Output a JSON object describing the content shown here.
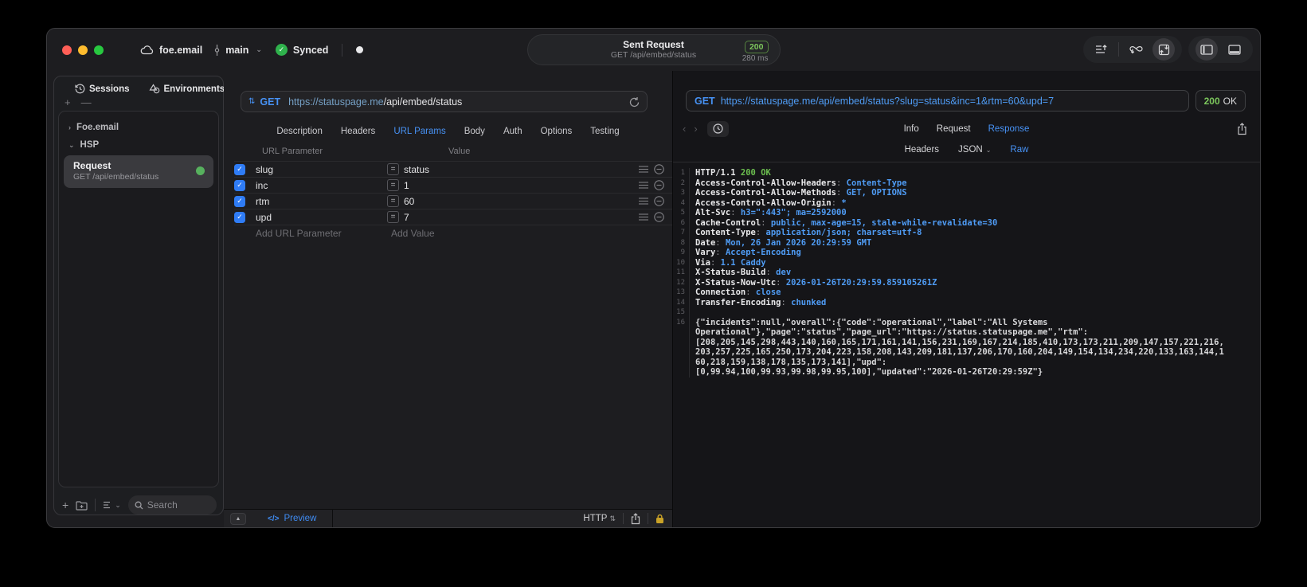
{
  "titlebar": {
    "project": "foe.email",
    "branch": "main",
    "sync_status": "Synced",
    "request_title": "Sent Request",
    "request_subtitle": "GET /api/embed/status",
    "status_badge": "200",
    "duration": "280 ms"
  },
  "sidebar": {
    "tabs": [
      {
        "label": "Sessions"
      },
      {
        "label": "Environments"
      }
    ],
    "groups": [
      {
        "label": "Foe.email"
      },
      {
        "label": "HSP"
      }
    ],
    "request_item": {
      "title": "Request",
      "subtitle": "GET /api/embed/status"
    },
    "search_placeholder": "Search"
  },
  "request_panel": {
    "method": "GET",
    "url_host": "https://statuspage.me",
    "url_path": "/api/embed/status",
    "tabs": [
      "Description",
      "Headers",
      "URL Params",
      "Body",
      "Auth",
      "Options",
      "Testing"
    ],
    "active_tab": "URL Params",
    "params": {
      "col_param": "URL Parameter",
      "col_value": "Value",
      "rows": [
        {
          "name": "slug",
          "value": "status",
          "enabled": true
        },
        {
          "name": "inc",
          "value": "1",
          "enabled": true
        },
        {
          "name": "rtm",
          "value": "60",
          "enabled": true
        },
        {
          "name": "upd",
          "value": "7",
          "enabled": true
        }
      ],
      "add_param_placeholder": "Add URL Parameter",
      "add_value_placeholder": "Add Value"
    },
    "footer": {
      "preview_label": "Preview",
      "code_glyph": "</>",
      "protocol_label": "HTTP"
    }
  },
  "response_panel": {
    "method": "GET",
    "url": "https://statuspage.me/api/embed/status?slug=status&inc=1&rtm=60&upd=7",
    "status_code": "200",
    "status_text": "OK",
    "tabs": [
      "Info",
      "Request",
      "Response"
    ],
    "active_tab": "Response",
    "subtabs": [
      "Headers",
      "JSON",
      "Raw"
    ],
    "active_subtab": "Raw",
    "status_line": {
      "protocol": "HTTP/1.1 ",
      "status": "200 OK"
    },
    "headers": [
      {
        "name": "Access-Control-Allow-Headers",
        "value": "Content-Type"
      },
      {
        "name": "Access-Control-Allow-Methods",
        "value": "GET, OPTIONS"
      },
      {
        "name": "Access-Control-Allow-Origin",
        "value": "*"
      },
      {
        "name": "Alt-Svc",
        "value": "h3=\":443\"; ma=2592000"
      },
      {
        "name": "Cache-Control",
        "value": "public, max-age=15, stale-while-revalidate=30"
      },
      {
        "name": "Content-Type",
        "value": "application/json; charset=utf-8"
      },
      {
        "name": "Date",
        "value": "Mon, 26 Jan 2026 20:29:59 GMT"
      },
      {
        "name": "Vary",
        "value": "Accept-Encoding"
      },
      {
        "name": "Via",
        "value": "1.1 Caddy"
      },
      {
        "name": "X-Status-Build",
        "value": "dev"
      },
      {
        "name": "X-Status-Now-Utc",
        "value": "2026-01-26T20:29:59.859105261Z"
      },
      {
        "name": "Connection",
        "value": "close"
      },
      {
        "name": "Transfer-Encoding",
        "value": "chunked"
      }
    ],
    "body_lines": [
      "{\"incidents\":null,\"overall\":{\"code\":\"operational\",\"label\":\"All Systems",
      "Operational\"},\"page\":\"status\",\"page_url\":\"https://status.statuspage.me\",\"rtm\":",
      "[208,205,145,298,443,140,160,165,171,161,141,156,231,169,167,214,185,410,173,173,211,209,147,157,221,216,",
      "203,257,225,165,250,173,204,223,158,208,143,209,181,137,206,170,160,204,149,154,134,234,220,133,163,144,1",
      "60,218,159,138,178,135,173,141],\"upd\":",
      "[0,99.94,100,99.93,99.98,99.95,100],\"updated\":\"2026-01-26T20:29:59Z\"}"
    ]
  },
  "colors": {
    "accent_blue": "#4792f5",
    "status_green": "#7cc75c",
    "checkbox_blue": "#2f7cf6",
    "traffic_red": "#ff5f57",
    "traffic_yellow": "#febc2e",
    "traffic_green": "#28c840"
  }
}
